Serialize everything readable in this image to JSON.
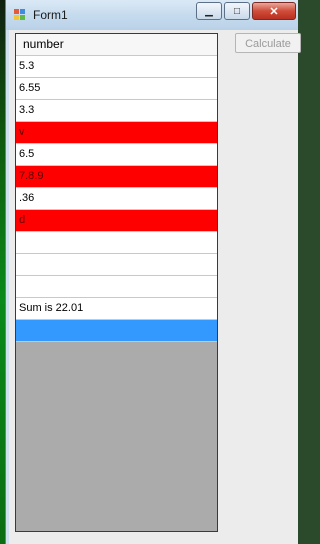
{
  "window": {
    "title": "Form1",
    "controls": {
      "minimize": "▁",
      "maximize": "□",
      "close": "✕"
    }
  },
  "toolbar": {
    "calculate_label": "Calculate",
    "calculate_enabled": false
  },
  "grid": {
    "column_header": "number",
    "rows": [
      {
        "value": "5.3",
        "invalid": false
      },
      {
        "value": "6.55",
        "invalid": false
      },
      {
        "value": "3.3",
        "invalid": false
      },
      {
        "value": "v",
        "invalid": true
      },
      {
        "value": "6.5",
        "invalid": false
      },
      {
        "value": "7.8.9",
        "invalid": true
      },
      {
        "value": ".36",
        "invalid": false
      },
      {
        "value": "d",
        "invalid": true
      },
      {
        "value": "",
        "invalid": false
      },
      {
        "value": "",
        "invalid": false
      },
      {
        "value": "",
        "invalid": false
      },
      {
        "value": "Sum is 22.01",
        "invalid": false
      },
      {
        "value": "",
        "invalid": false,
        "selected": true
      }
    ]
  },
  "colors": {
    "invalid_row": "#ff0000",
    "selected_row": "#3399ff",
    "grid_background": "#ababab"
  },
  "icons": {
    "app": "app-icon",
    "minimize": "minimize-icon",
    "maximize": "maximize-icon",
    "close": "close-icon"
  }
}
